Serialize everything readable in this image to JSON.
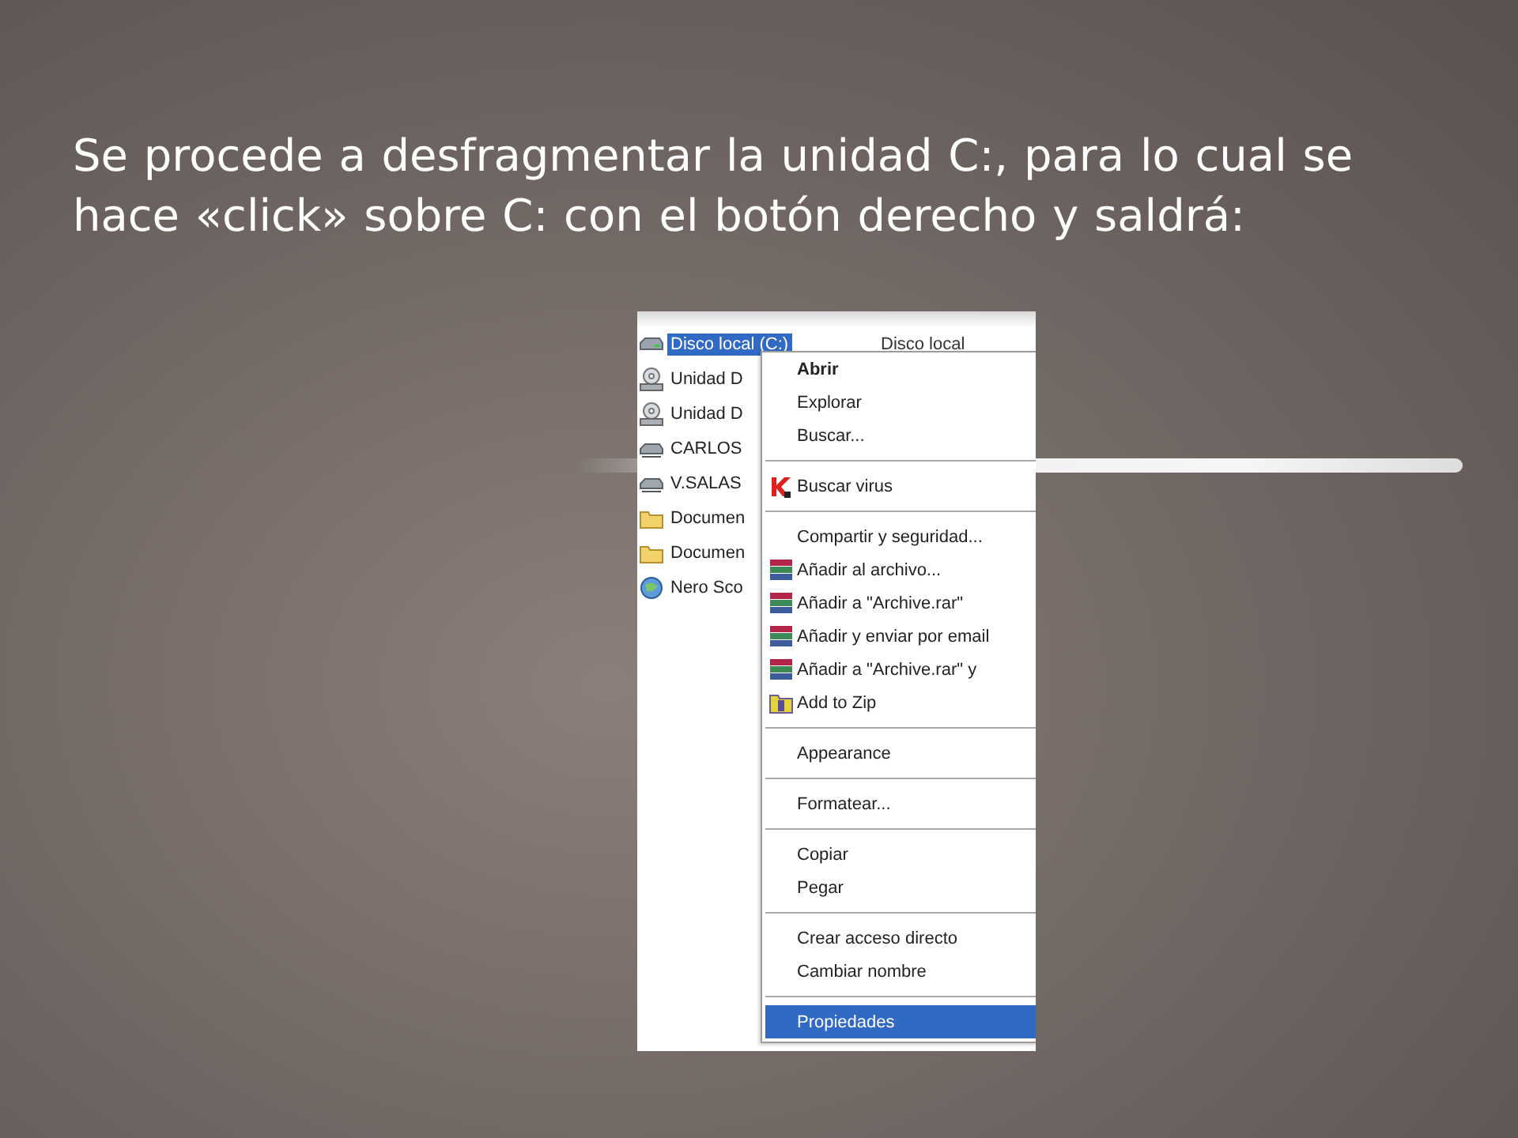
{
  "slide": {
    "title": "Se procede a desfragmentar la unidad C:, para lo cual se hace «click» sobre C: con el botón derecho y saldrá:"
  },
  "explorer": {
    "files": [
      {
        "name": "Disco local (C:)",
        "type": "Disco local",
        "kind": "drive",
        "selected": true
      },
      {
        "name": "Unidad D",
        "kind": "cd-drive",
        "selected": false
      },
      {
        "name": "Unidad D",
        "kind": "cd-drive",
        "selected": false
      },
      {
        "name": "CARLOS",
        "kind": "network-drive",
        "selected": false
      },
      {
        "name": "V.SALAS",
        "kind": "network-drive",
        "selected": false
      },
      {
        "name": "Documen",
        "kind": "folder",
        "selected": false
      },
      {
        "name": "Documen",
        "kind": "folder",
        "selected": false
      },
      {
        "name": "Nero Sco",
        "kind": "app",
        "selected": false
      }
    ],
    "context_menu": [
      {
        "kind": "default",
        "label": "Abrir",
        "selected": false
      },
      {
        "kind": "plain",
        "label": "Explorar",
        "selected": false
      },
      {
        "kind": "plain",
        "label": "Buscar...",
        "selected": false
      },
      {
        "kind": "separator"
      },
      {
        "kind": "antivirus",
        "label": "Buscar virus",
        "selected": false
      },
      {
        "kind": "separator"
      },
      {
        "kind": "plain",
        "label": "Compartir y seguridad...",
        "selected": false
      },
      {
        "kind": "archive",
        "label": "Añadir al archivo...",
        "selected": false
      },
      {
        "kind": "archive",
        "label": "Añadir a \"Archive.rar\"",
        "selected": false
      },
      {
        "kind": "archive",
        "label": "Añadir y enviar por email",
        "selected": false
      },
      {
        "kind": "archive",
        "label": "Añadir a \"Archive.rar\" y",
        "selected": false
      },
      {
        "kind": "zip",
        "label": "Add to Zip",
        "selected": false
      },
      {
        "kind": "separator"
      },
      {
        "kind": "plain",
        "label": "Appearance",
        "selected": false
      },
      {
        "kind": "separator"
      },
      {
        "kind": "plain",
        "label": "Formatear...",
        "selected": false
      },
      {
        "kind": "separator"
      },
      {
        "kind": "plain",
        "label": "Copiar",
        "selected": false
      },
      {
        "kind": "plain",
        "label": "Pegar",
        "selected": false
      },
      {
        "kind": "separator"
      },
      {
        "kind": "plain",
        "label": "Crear acceso directo",
        "selected": false
      },
      {
        "kind": "plain",
        "label": "Cambiar nombre",
        "selected": false
      },
      {
        "kind": "separator"
      },
      {
        "kind": "plain",
        "label": "Propiedades",
        "selected": true
      }
    ]
  }
}
